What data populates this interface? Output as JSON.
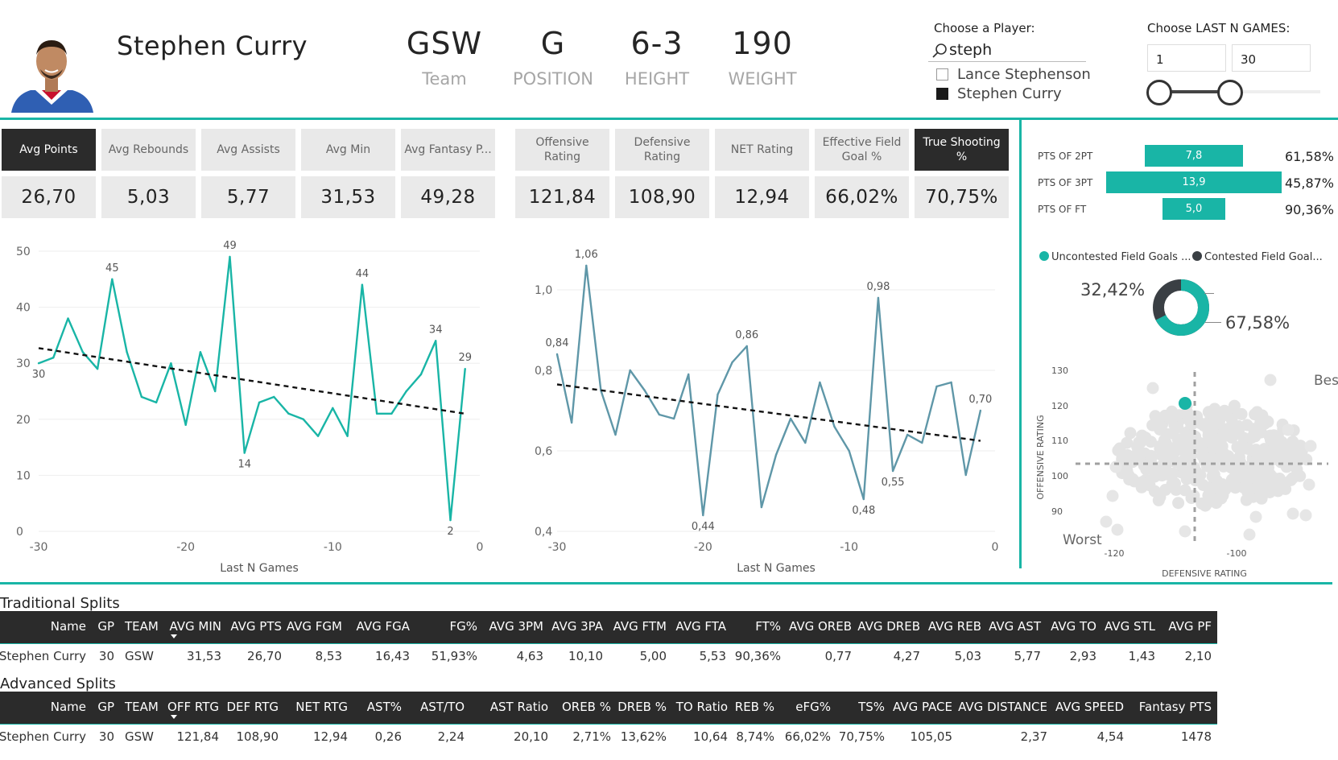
{
  "header": {
    "player_name": "Stephen Curry",
    "stats": [
      {
        "value": "GSW",
        "label": "Team"
      },
      {
        "value": "G",
        "label": "POSITION"
      },
      {
        "value": "6-3",
        "label": "HEIGHT"
      },
      {
        "value": "190",
        "label": "WEIGHT"
      }
    ]
  },
  "player_filter": {
    "label": "Choose a Player:",
    "search_value": "steph",
    "options": [
      {
        "label": "Lance Stephenson",
        "checked": false
      },
      {
        "label": "Stephen Curry",
        "checked": true
      }
    ]
  },
  "games_filter": {
    "label": "Choose LAST N GAMES:",
    "min_value": "1",
    "max_value": "30"
  },
  "kpis_left": [
    {
      "label": "Avg Points",
      "value": "26,70",
      "selected": true
    },
    {
      "label": "Avg Rebounds",
      "value": "5,03",
      "selected": false
    },
    {
      "label": "Avg Assists",
      "value": "5,77",
      "selected": false
    },
    {
      "label": "Avg Min",
      "value": "31,53",
      "selected": false
    },
    {
      "label": "Avg Fantasy P...",
      "value": "49,28",
      "selected": false
    }
  ],
  "kpis_right": [
    {
      "label": "Offensive Rating",
      "value": "121,84",
      "selected": false
    },
    {
      "label": "Defensive Rating",
      "value": "108,90",
      "selected": false
    },
    {
      "label": "NET Rating",
      "value": "12,94",
      "selected": false
    },
    {
      "label": "Effective Field Goal %",
      "value": "66,02%",
      "selected": false
    },
    {
      "label": "True Shooting %",
      "value": "70,75%",
      "selected": true
    }
  ],
  "shooting_split": [
    {
      "label": "PTS OF 2PT",
      "value": "7,8",
      "pct": "61,58%"
    },
    {
      "label": "PTS OF 3PT",
      "value": "13,9",
      "pct": "45,87%"
    },
    {
      "label": "PTS OF FT",
      "value": "5,0",
      "pct": "90,36%"
    }
  ],
  "donut": {
    "legend": [
      {
        "label": "Uncontested Field Goals ...",
        "color": "#19b5a6"
      },
      {
        "label": "Contested Field Goal...",
        "color": "#3a3f44"
      }
    ],
    "uncontested_pct_label": "67,58%",
    "contested_pct_label": "32,42%",
    "uncontested_value": 67.58,
    "contested_value": 32.42
  },
  "scatter": {
    "best_label": "Best",
    "worst_label": "Worst",
    "xlabel": "DEFENSIVE RATING",
    "ylabel": "OFFENSIVE RATING",
    "xticks": [
      "-120",
      "-100"
    ],
    "yticks": [
      "130",
      "120",
      "110",
      "100",
      "90"
    ]
  },
  "chart_data": [
    {
      "type": "line",
      "title": "",
      "xlabel": "Last N Games",
      "ylabel": "",
      "xlim": [
        -30,
        0
      ],
      "ylim": [
        0,
        50
      ],
      "xticks": [
        "-30",
        "-20",
        "-10",
        "0"
      ],
      "yticks": [
        "0",
        "10",
        "20",
        "30",
        "40",
        "50"
      ],
      "x": [
        -30,
        -29,
        -28,
        -27,
        -26,
        -25,
        -24,
        -23,
        -22,
        -21,
        -20,
        -19,
        -18,
        -17,
        -16,
        -15,
        -14,
        -13,
        -12,
        -11,
        -10,
        -9,
        -8,
        -7,
        -6,
        -5,
        -4,
        -3,
        -2,
        -1
      ],
      "series": [
        {
          "values": [
            30,
            31,
            38,
            32,
            29,
            45,
            32,
            24,
            23,
            30,
            19,
            32,
            25,
            49,
            14,
            23,
            24,
            21,
            20,
            17,
            22,
            17,
            44,
            21,
            21,
            25,
            28,
            34,
            2,
            29
          ],
          "color": "#19b5a6"
        }
      ],
      "trendline": {
        "start": 32.7,
        "end": 21.0
      },
      "data_labels": [
        {
          "x": -30,
          "text": "30"
        },
        {
          "x": -25,
          "text": "45"
        },
        {
          "x": -17,
          "text": "49"
        },
        {
          "x": -16,
          "text": "14"
        },
        {
          "x": -8,
          "text": "44"
        },
        {
          "x": -3,
          "text": "34"
        },
        {
          "x": -2,
          "text": "2"
        },
        {
          "x": -1,
          "text": "29"
        }
      ]
    },
    {
      "type": "line",
      "title": "",
      "xlabel": "Last N Games",
      "ylabel": "",
      "xlim": [
        -30,
        0
      ],
      "ylim": [
        0.4,
        1.0
      ],
      "xticks": [
        "-30",
        "-20",
        "-10",
        "0"
      ],
      "yticks": [
        "0,4",
        "0,6",
        "0,8",
        "1,0"
      ],
      "x": [
        -30,
        -29,
        -28,
        -27,
        -26,
        -25,
        -24,
        -23,
        -22,
        -21,
        -20,
        -19,
        -18,
        -17,
        -16,
        -15,
        -14,
        -13,
        -12,
        -11,
        -10,
        -9,
        -8,
        -7,
        -6,
        -5,
        -4,
        -3,
        -2,
        -1
      ],
      "series": [
        {
          "values": [
            0.84,
            0.67,
            1.06,
            0.75,
            0.64,
            0.8,
            0.75,
            0.69,
            0.68,
            0.79,
            0.44,
            0.74,
            0.82,
            0.86,
            0.46,
            0.59,
            0.68,
            0.62,
            0.77,
            0.66,
            0.6,
            0.48,
            0.98,
            0.55,
            0.64,
            0.62,
            0.76,
            0.77,
            0.54,
            0.7
          ],
          "color": "#5f97a8"
        }
      ],
      "trendline": {
        "start": 0.765,
        "end": 0.625
      },
      "data_labels": [
        {
          "x": -30,
          "text": "0,84"
        },
        {
          "x": -28,
          "text": "1,06"
        },
        {
          "x": -20,
          "text": "0,44"
        },
        {
          "x": -17,
          "text": "0,86"
        },
        {
          "x": -9,
          "text": "0,48"
        },
        {
          "x": -8,
          "text": "0,98"
        },
        {
          "x": -7,
          "text": "0,55"
        },
        {
          "x": -1,
          "text": "0,70"
        }
      ]
    }
  ],
  "traditional": {
    "title": "Traditional Splits",
    "headers": [
      "Name",
      "GP",
      "TEAM",
      "AVG MIN",
      "AVG PTS",
      "AVG FGM",
      "AVG FGA",
      "FG%",
      "AVG 3PM",
      "AVG 3PA",
      "AVG FTM",
      "AVG FTA",
      "FT%",
      "AVG OREB",
      "AVG DREB",
      "AVG REB",
      "AVG AST",
      "AVG TO",
      "AVG STL",
      "AVG PF"
    ],
    "row": [
      "Stephen Curry",
      "30",
      "GSW",
      "31,53",
      "26,70",
      "8,53",
      "16,43",
      "51,93%",
      "4,63",
      "10,10",
      "5,00",
      "5,53",
      "90,36%",
      "0,77",
      "4,27",
      "5,03",
      "5,77",
      "2,93",
      "1,43",
      "2,10"
    ]
  },
  "advanced": {
    "title": "Advanced Splits",
    "headers": [
      "Name",
      "GP",
      "TEAM",
      "OFF RTG",
      "DEF RTG",
      "NET RTG",
      "AST%",
      "AST/TO",
      "AST Ratio",
      "OREB %",
      "DREB %",
      "TO Ratio",
      "REB %",
      "eFG%",
      "TS%",
      "AVG PACE",
      "AVG DISTANCE",
      "AVG SPEED",
      "Fantasy PTS"
    ],
    "row": [
      "Stephen Curry",
      "30",
      "GSW",
      "121,84",
      "108,90",
      "12,94",
      "0,26",
      "2,24",
      "20,10",
      "2,71%",
      "13,62%",
      "10,64",
      "8,74%",
      "66,02%",
      "70,75%",
      "105,05",
      "2,37",
      "4,54",
      "1478"
    ]
  }
}
